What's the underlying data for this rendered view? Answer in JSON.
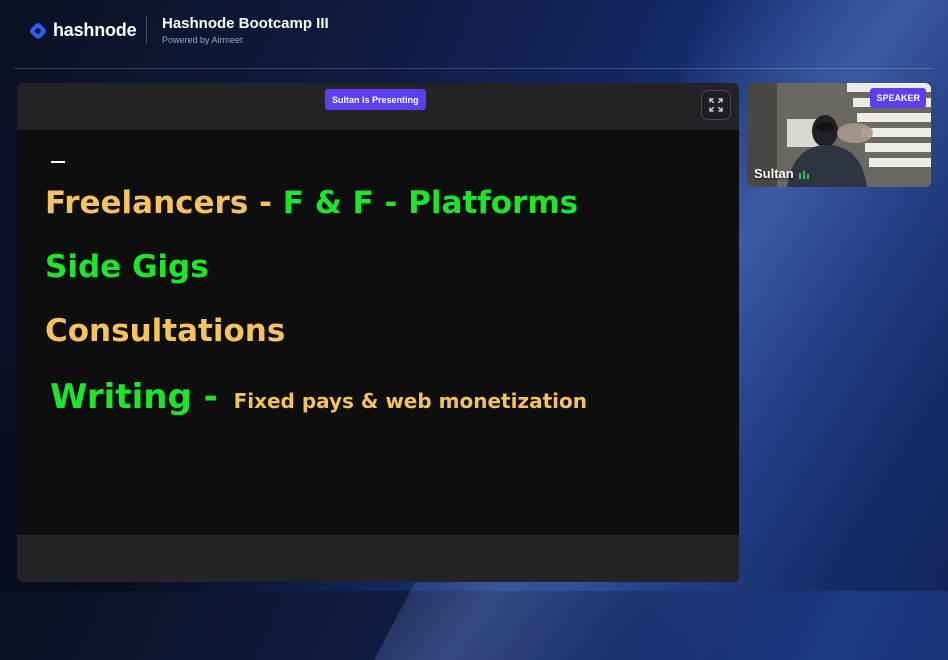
{
  "header": {
    "brand": "hashnode",
    "event_title": "Hashnode Bootcamp III",
    "powered_by": "Powered by Airmeet"
  },
  "stage": {
    "presenting_label": "Sultan Is Presenting",
    "fullscreen_icon": "expand-icon",
    "slide": {
      "line1_part1": "Freelancers - ",
      "line1_part2": "F & F - Platforms",
      "line2": "Side Gigs",
      "line3": "Consultations",
      "line4_main": "Writing - ",
      "line4_sub": "Fixed pays & web monetization"
    }
  },
  "speaker": {
    "badge": "SPEAKER",
    "name": "Sultan",
    "audio_icon": "audio-level-icon"
  },
  "colors": {
    "accent": "#5b3ff0",
    "slide_yellow": "#f4c25e",
    "slide_green": "#1fe52a",
    "logo_blue": "#2962ff"
  }
}
